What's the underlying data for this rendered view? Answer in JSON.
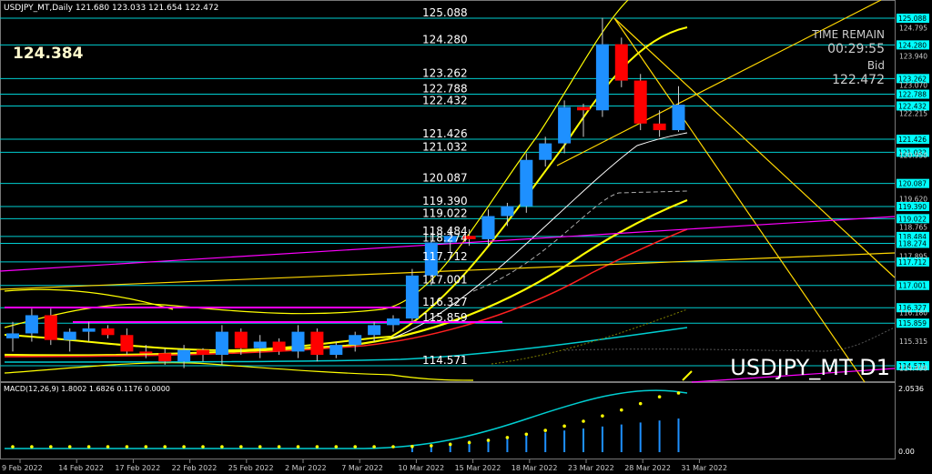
{
  "header": {
    "symbol_line": "USDJPY_MT,Daily  121.680 123.033 121.654 122.472"
  },
  "current_price_large": "124.384",
  "info": {
    "time_remain_label": "TIME REMAIN",
    "time_remain_value": "00:29:55",
    "bid_label": "Bid",
    "bid_value": "122.472"
  },
  "watermark": "USDJPY_MT D1",
  "macd": {
    "label": "MACD(12,26,9) 1.8002 1.6826 0.1176 0.0000",
    "scale_top": "2.0536",
    "scale_zero": "0.00"
  },
  "price_scale": [
    "124.795",
    "123.940",
    "123.070",
    "122.215",
    "120.950",
    "119.620",
    "118.765",
    "117.895",
    "116.180",
    "115.315",
    "114.498"
  ],
  "level_lines": [
    "125.088",
    "124.280",
    "123.262",
    "122.788",
    "122.432",
    "121.426",
    "121.032",
    "120.087",
    "119.390",
    "119.022",
    "118.484",
    "118.274",
    "117.712",
    "117.001",
    "116.327",
    "115.859",
    "114.571"
  ],
  "date_labels": [
    "9 Feb 2022",
    "14 Feb 2022",
    "17 Feb 2022",
    "22 Feb 2022",
    "25 Feb 2022",
    "2 Mar 2022",
    "7 Mar 2022",
    "10 Mar 2022",
    "15 Mar 2022",
    "18 Mar 2022",
    "23 Mar 2022",
    "28 Mar 2022",
    "31 Mar 2022"
  ],
  "colors": {
    "background": "#000000",
    "bull": "#1e90ff",
    "bear": "#ff0000",
    "level_line": "#00ced1",
    "label_bg": "#00ffff",
    "ma_yellow": "#ffff00",
    "ma_red": "#ff2020",
    "ma_aqua": "#00ced1",
    "trendline_gold": "#ffd700",
    "magenta": "#ff00ff",
    "macd_line": "#00ced1",
    "macd_signal": "#ffff00"
  },
  "chart_data": {
    "type": "candlestick",
    "symbol": "USDJPY_MT",
    "timeframe": "D1",
    "candles": [
      {
        "open": 115.4,
        "high": 115.9,
        "low": 115.0,
        "close": 115.55
      },
      {
        "open": 115.55,
        "high": 116.3,
        "low": 115.3,
        "close": 116.1
      },
      {
        "open": 116.1,
        "high": 116.3,
        "low": 115.2,
        "close": 115.35
      },
      {
        "open": 115.35,
        "high": 115.7,
        "low": 115.0,
        "close": 115.6
      },
      {
        "open": 115.6,
        "high": 115.9,
        "low": 115.3,
        "close": 115.7
      },
      {
        "open": 115.7,
        "high": 115.8,
        "low": 115.4,
        "close": 115.5
      },
      {
        "open": 115.5,
        "high": 115.7,
        "low": 114.9,
        "close": 115.0
      },
      {
        "open": 115.0,
        "high": 115.2,
        "low": 114.8,
        "close": 114.95
      },
      {
        "open": 114.95,
        "high": 115.1,
        "low": 114.6,
        "close": 114.7
      },
      {
        "open": 114.7,
        "high": 115.2,
        "low": 114.5,
        "close": 115.05
      },
      {
        "open": 115.05,
        "high": 115.1,
        "low": 114.7,
        "close": 114.9
      },
      {
        "open": 114.9,
        "high": 115.8,
        "low": 114.6,
        "close": 115.6
      },
      {
        "open": 115.6,
        "high": 115.7,
        "low": 114.9,
        "close": 115.1
      },
      {
        "open": 115.1,
        "high": 115.5,
        "low": 114.8,
        "close": 115.3
      },
      {
        "open": 115.3,
        "high": 115.4,
        "low": 114.9,
        "close": 115.0
      },
      {
        "open": 115.0,
        "high": 115.8,
        "low": 114.8,
        "close": 115.6
      },
      {
        "open": 115.6,
        "high": 115.7,
        "low": 114.7,
        "close": 114.9
      },
      {
        "open": 114.9,
        "high": 115.3,
        "low": 114.8,
        "close": 115.2
      },
      {
        "open": 115.2,
        "high": 115.6,
        "low": 115.0,
        "close": 115.5
      },
      {
        "open": 115.5,
        "high": 115.9,
        "low": 115.3,
        "close": 115.8
      },
      {
        "open": 115.8,
        "high": 116.1,
        "low": 115.6,
        "close": 116.0
      },
      {
        "open": 116.0,
        "high": 117.5,
        "low": 115.9,
        "close": 117.3
      },
      {
        "open": 117.3,
        "high": 118.6,
        "low": 117.0,
        "close": 118.3
      },
      {
        "open": 118.3,
        "high": 118.7,
        "low": 118.0,
        "close": 118.5
      },
      {
        "open": 118.5,
        "high": 118.7,
        "low": 118.2,
        "close": 118.4
      },
      {
        "open": 118.4,
        "high": 119.3,
        "low": 118.2,
        "close": 119.1
      },
      {
        "open": 119.1,
        "high": 119.5,
        "low": 118.8,
        "close": 119.4
      },
      {
        "open": 119.4,
        "high": 121.0,
        "low": 119.2,
        "close": 120.8
      },
      {
        "open": 120.8,
        "high": 121.5,
        "low": 120.6,
        "close": 121.3
      },
      {
        "open": 121.3,
        "high": 122.6,
        "low": 121.0,
        "close": 122.4
      },
      {
        "open": 122.4,
        "high": 122.5,
        "low": 121.5,
        "close": 122.3
      },
      {
        "open": 122.3,
        "high": 125.1,
        "low": 122.1,
        "close": 124.3
      },
      {
        "open": 124.3,
        "high": 124.5,
        "low": 123.0,
        "close": 123.2
      },
      {
        "open": 123.2,
        "high": 123.4,
        "low": 121.7,
        "close": 121.9
      },
      {
        "open": 121.9,
        "high": 122.3,
        "low": 121.5,
        "close": 121.7
      },
      {
        "open": 121.7,
        "high": 123.03,
        "low": 121.65,
        "close": 122.47
      }
    ],
    "indicators": [
      "MACD(12,26,9)"
    ],
    "ylim": [
      114.1,
      125.6
    ],
    "grid": false
  }
}
